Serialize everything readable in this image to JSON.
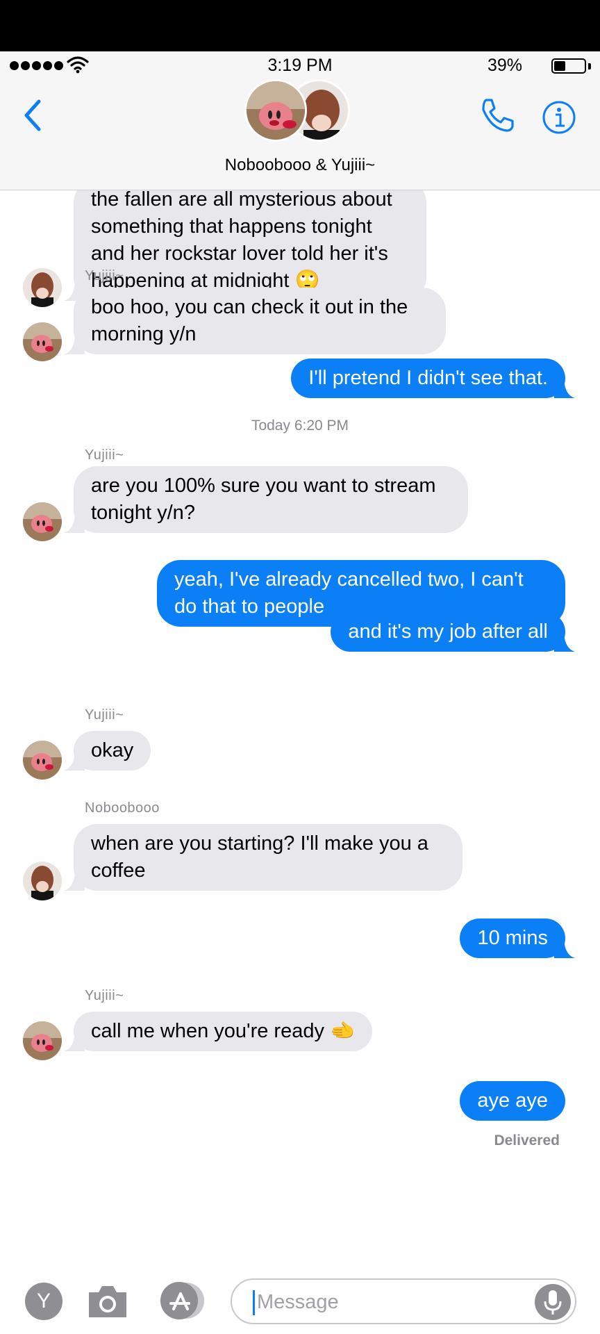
{
  "status_bar": {
    "time": "3:19 PM",
    "battery_percent": "39%",
    "battery_level": 0.39
  },
  "header": {
    "contact_name": "Noboobooo & Yujiii~"
  },
  "messages": [
    {
      "direction": "in",
      "sender": "",
      "text": "the fallen are all mysterious about something that happens tonight and her rockstar lover told her it's happening at midnight 🙄",
      "avatar": "noboobooo-avatar"
    },
    {
      "direction": "in",
      "sender": "Yujiii~",
      "text": "boo hoo, you can check it out in the morning y/n",
      "avatar": "yujiii-avatar"
    },
    {
      "direction": "out",
      "text": "I'll pretend I didn't see that."
    },
    {
      "direction": "in",
      "sender": "Yujiii~",
      "text": "are you 100% sure you want to stream tonight y/n?",
      "avatar": "yujiii-avatar"
    },
    {
      "direction": "out",
      "text": "yeah, I've already cancelled two, I can't do that to people"
    },
    {
      "direction": "out",
      "text": "and it's my job after all"
    },
    {
      "direction": "in",
      "sender": "Yujiii~",
      "text": "okay",
      "avatar": "yujiii-avatar"
    },
    {
      "direction": "in",
      "sender": "Noboobooo",
      "text": "when are you starting? I'll make you a coffee",
      "avatar": "noboobooo-avatar"
    },
    {
      "direction": "out",
      "text": "10 mins"
    },
    {
      "direction": "in",
      "sender": "Yujiii~",
      "text": "call me when you're ready 🫲",
      "avatar": "yujiii-avatar"
    },
    {
      "direction": "out",
      "text": "aye aye"
    }
  ],
  "timestamp": "Today 6:20 PM",
  "delivered_label": "Delivered",
  "input_bar": {
    "y_button": "Y",
    "message_placeholder": "Message"
  },
  "colors": {
    "outgoing": "#0b7ff5",
    "incoming": "#e8e8ec",
    "accent": "#0b7ff5"
  }
}
